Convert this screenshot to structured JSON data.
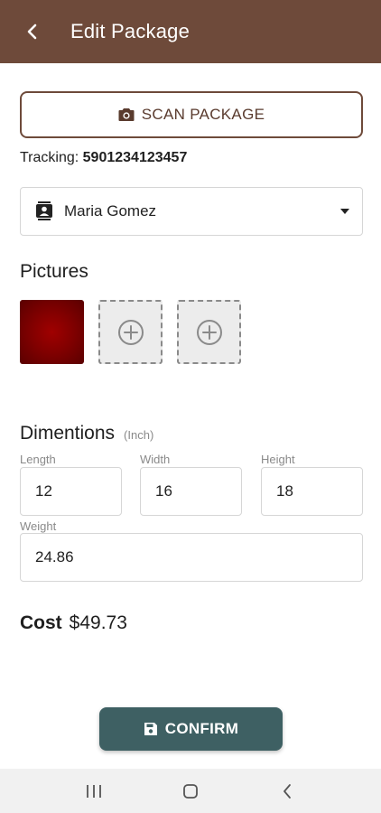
{
  "header": {
    "title": "Edit Package",
    "back_icon": "chevron-left-icon"
  },
  "scan": {
    "label": "SCAN PACKAGE",
    "icon": "camera-icon"
  },
  "tracking": {
    "label": "Tracking:",
    "number": "5901234123457"
  },
  "customer": {
    "selected": "Maria Gomez",
    "icon": "contact-card-icon"
  },
  "pictures": {
    "title": "Pictures",
    "count": 1,
    "add_slots": 2
  },
  "dimensions": {
    "title": "Dimentions",
    "unit": "(Inch)",
    "length": {
      "label": "Length",
      "value": "12"
    },
    "width": {
      "label": "Width",
      "value": "16"
    },
    "height": {
      "label": "Height",
      "value": "18"
    },
    "weight": {
      "label": "Weight",
      "value": "24.86"
    }
  },
  "cost": {
    "label": "Cost",
    "value": "$49.73"
  },
  "confirm": {
    "label": "CONFIRM",
    "icon": "save-icon"
  },
  "colors": {
    "appbar": "#6e4a3a",
    "confirm": "#3e6063",
    "picture": "#8b0000"
  }
}
